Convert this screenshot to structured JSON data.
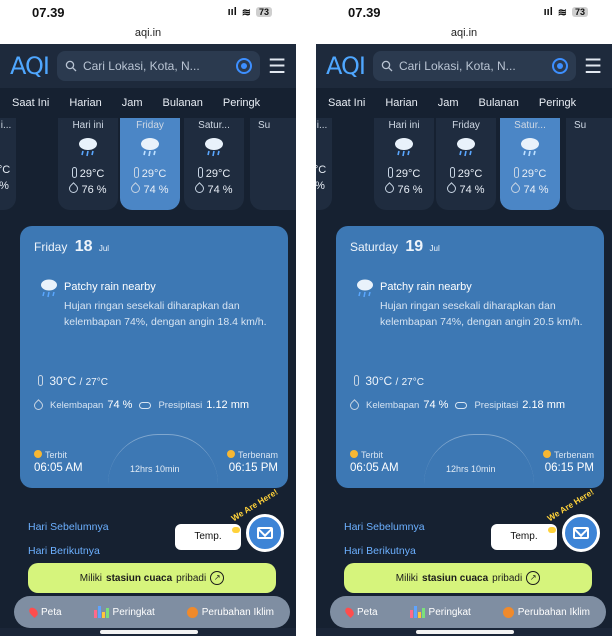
{
  "left": {
    "status": {
      "time": "07.39",
      "signal": "ııl",
      "wifi": "≋",
      "battery": "73"
    },
    "url": "aqi.in",
    "logo": "AQI",
    "search_placeholder": "Cari Lokasi, Kota, N...",
    "tabs": [
      "Saat Ini",
      "Harian",
      "Jam",
      "Bulanan",
      "Peringk"
    ],
    "days": [
      {
        "name": "i...",
        "temp": "°C",
        "hum": "%"
      },
      {
        "name": "Hari ini",
        "temp": "29°C",
        "hum": "76 %"
      },
      {
        "name": "Friday",
        "temp": "29°C",
        "hum": "74 %"
      },
      {
        "name": "Satur...",
        "temp": "29°C",
        "hum": "74 %"
      },
      {
        "name": "Su",
        "temp": "",
        "hum": ""
      }
    ],
    "card": {
      "day": "Friday",
      "date": "18",
      "month": "Jul",
      "condition": "Patchy rain nearby",
      "description": "Hujan ringan sesekali diharapkan dan kelembapan 74%, dengan angin 18.4 km/h.",
      "temp_high": "30°C",
      "temp_sep": "/",
      "temp_low": "27°C",
      "humidity_label": "Kelembapan",
      "humidity_value": "74 %",
      "precip_label": "Presipitasi",
      "precip_value": "1.12 mm",
      "sunrise_label": "Terbit",
      "sunrise_time": "06:05 AM",
      "duration": "12hrs 10min",
      "sunset_label": "Terbenam",
      "sunset_time": "06:15 PM"
    },
    "links": [
      "Hari Sebelumnya",
      "Hari Berikutnya"
    ],
    "temp_button": "Temp.",
    "fab_banner": "We Are Here!",
    "promo_prefix": "Miliki",
    "promo_bold": "stasiun cuaca",
    "promo_suffix": "pribadi",
    "nav": [
      "Peta",
      "Peringkat",
      "Perubahan Iklim"
    ]
  },
  "right": {
    "status": {
      "time": "07.39",
      "signal": "ııl",
      "wifi": "≋",
      "battery": "73"
    },
    "url": "aqi.in",
    "logo": "AQI",
    "search_placeholder": "Cari Lokasi, Kota, N...",
    "tabs": [
      "Saat Ini",
      "Harian",
      "Jam",
      "Bulanan",
      "Peringk"
    ],
    "days": [
      {
        "name": "i...",
        "temp": "°C",
        "hum": "%"
      },
      {
        "name": "Hari ini",
        "temp": "29°C",
        "hum": "76 %"
      },
      {
        "name": "Friday",
        "temp": "29°C",
        "hum": "74 %"
      },
      {
        "name": "Satur...",
        "temp": "29°C",
        "hum": "74 %"
      },
      {
        "name": "Su",
        "temp": "",
        "hum": ""
      }
    ],
    "card": {
      "day": "Saturday",
      "date": "19",
      "month": "Jul",
      "condition": "Patchy rain nearby",
      "description": "Hujan ringan sesekali diharapkan dan kelembapan 74%, dengan angin 20.5 km/h.",
      "temp_high": "30°C",
      "temp_sep": "/",
      "temp_low": "27°C",
      "humidity_label": "Kelembapan",
      "humidity_value": "74 %",
      "precip_label": "Presipitasi",
      "precip_value": "2.18 mm",
      "sunrise_label": "Terbit",
      "sunrise_time": "06:05 AM",
      "duration": "12hrs 10min",
      "sunset_label": "Terbenam",
      "sunset_time": "06:15 PM"
    },
    "links": [
      "Hari Sebelumnya",
      "Hari Berikutnya"
    ],
    "temp_button": "Temp.",
    "fab_banner": "We Are Here!",
    "promo_prefix": "Miliki",
    "promo_bold": "stasiun cuaca",
    "promo_suffix": "pribadi",
    "nav": [
      "Peta",
      "Peringkat",
      "Perubahan Iklim"
    ]
  },
  "colors": {
    "card": "#3d78b4",
    "active_day": "#4b86c6",
    "background": "#162131",
    "promo": "#d6f47c",
    "link": "#6cb0ff"
  },
  "icons": [
    "search-icon",
    "location-icon",
    "menu-icon",
    "rain-cloud-icon",
    "thermometer-icon",
    "humidity-icon",
    "cloud-icon",
    "sunrise-icon",
    "sunset-icon",
    "mail-icon",
    "map-pin-icon",
    "ranking-bars-icon",
    "globe-icon"
  ]
}
